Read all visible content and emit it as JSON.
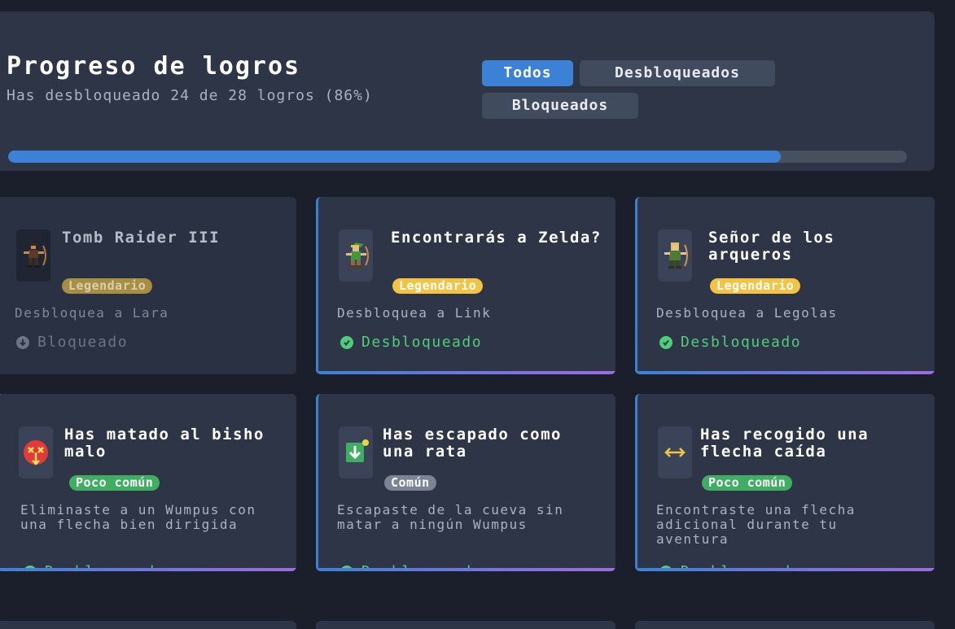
{
  "header": {
    "title": "Progreso de logros",
    "subtitle": "Has desbloqueado 24 de 28 logros (86%)",
    "progress_percent": 86
  },
  "filters": {
    "all": "Todos",
    "unlocked": "Desbloqueados",
    "locked": "Bloqueados",
    "active": "all"
  },
  "achievements": [
    {
      "title": "Tomb Raider III",
      "rarity": "Legendario",
      "description": "Desbloquea a Lara",
      "status": "Bloqueado",
      "icon": "lara-archer-icon"
    },
    {
      "title": "Encontrarás a Zelda?",
      "rarity": "Legendario",
      "description": "Desbloquea a Link",
      "status": "Desbloqueado",
      "icon": "link-archer-icon"
    },
    {
      "title": "Señor de los arqueros",
      "rarity": "Legendario",
      "description": "Desbloquea a Legolas",
      "status": "Desbloqueado",
      "icon": "legolas-archer-icon"
    },
    {
      "title": "Has matado al bisho malo",
      "rarity": "Poco común",
      "description": "Eliminaste a un Wumpus con una flecha bien dirigida",
      "status": "Desbloqueado",
      "icon": "wumpus-monster-icon"
    },
    {
      "title": "Has escapado como una rata",
      "rarity": "Común",
      "description": "Escapaste de la cueva sin matar a ningún Wumpus",
      "status": "Desbloqueado",
      "icon": "escape-exit-icon"
    },
    {
      "title": "Has recogido una flecha caída",
      "rarity": "Poco común",
      "description": "Encontraste una flecha adicional durante tu aventura",
      "status": "Desbloqueado",
      "icon": "arrow-pickup-icon"
    }
  ],
  "colors": {
    "accent": "#3b82d6",
    "legendary": "#f3c443",
    "uncommon": "#3fae63",
    "common": "#7b8496",
    "unlocked_status": "#4fce7a",
    "gradient_end": "#9d6ce0"
  }
}
